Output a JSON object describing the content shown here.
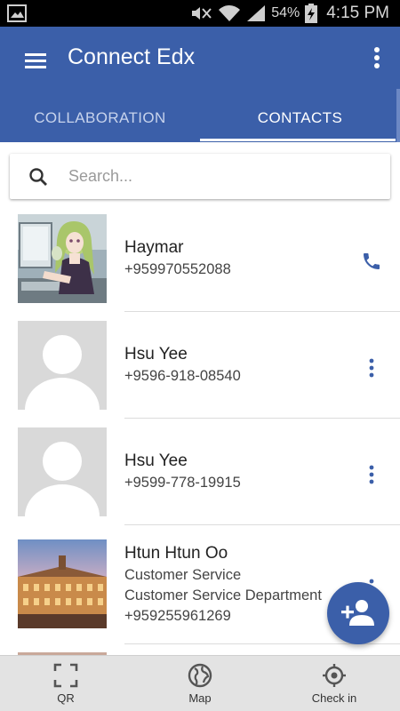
{
  "status_bar": {
    "battery_percent": "54%",
    "time": "4:15 PM"
  },
  "app_bar": {
    "title": "Connect Edx",
    "tabs": [
      {
        "label": "COLLABORATION",
        "active": false
      },
      {
        "label": "CONTACTS",
        "active": true
      }
    ]
  },
  "search": {
    "placeholder": "Search...",
    "value": ""
  },
  "contacts": [
    {
      "name": "Haymar",
      "lines": [
        "+959970552088"
      ],
      "avatar": "photo-anime-girl",
      "action": "phone-icon"
    },
    {
      "name": "Hsu Yee",
      "lines": [
        "+9596-918-08540"
      ],
      "avatar": "default-person",
      "action": "more-vert-icon"
    },
    {
      "name": "Hsu Yee",
      "lines": [
        "+9599-778-19915"
      ],
      "avatar": "default-person",
      "action": "more-vert-icon"
    },
    {
      "name": "Htun Htun Oo",
      "lines": [
        "Customer Service",
        "Customer Service Department",
        "+959255961269"
      ],
      "avatar": "photo-building",
      "action": "more-vert-icon"
    }
  ],
  "bottom_nav": [
    {
      "label": "QR",
      "icon": "qr-scan-icon"
    },
    {
      "label": "Map",
      "icon": "globe-icon"
    },
    {
      "label": "Check in",
      "icon": "location-target-icon"
    }
  ],
  "colors": {
    "primary": "#3b5fa9",
    "tab_inactive": "#c7d3ec",
    "bottom_nav_bg": "#e3e3e3"
  }
}
